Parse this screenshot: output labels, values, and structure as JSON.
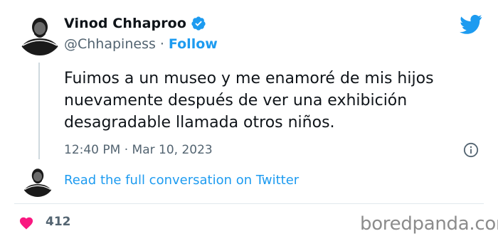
{
  "tweet": {
    "display_name": "Vinod Chhaproo",
    "handle": "@Chhapiness",
    "separator": "·",
    "follow_label": "Follow",
    "text_lines": [
      "Fuimos a un museo y me enamoré de mis hijos",
      "nuevamente después de ver una exhibición",
      "desagradable llamada otros niños."
    ],
    "timestamp": "12:40 PM · Mar 10, 2023",
    "read_more_label": "Read the full conversation on Twitter",
    "like_count": "412",
    "avatar_text": "Chhapiness"
  },
  "icons": {
    "verified": "verified-badge-icon",
    "twitter": "twitter-bird-icon",
    "info": "info-icon",
    "heart": "heart-icon"
  },
  "colors": {
    "accent": "#1d9bf0",
    "heart": "#f91880",
    "muted": "#536471",
    "text": "#0f1419"
  },
  "watermark": "boredpanda.com"
}
